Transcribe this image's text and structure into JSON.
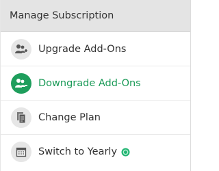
{
  "header": {
    "title": "Manage Subscription"
  },
  "menu": {
    "items": [
      {
        "label": "Upgrade Add-Ons",
        "icon": "upgrade-addons-icon",
        "active": false
      },
      {
        "label": "Downgrade Add-Ons",
        "icon": "downgrade-addons-icon",
        "active": true
      },
      {
        "label": "Change Plan",
        "icon": "change-plan-icon",
        "active": false
      },
      {
        "label": "Switch to Yearly",
        "icon": "calendar-icon",
        "active": false,
        "badge": "savings-badge-icon"
      }
    ]
  },
  "colors": {
    "header_bg": "#e4e4e4",
    "active_green": "#1a9a57",
    "icon_circle": "#e6e6e6",
    "badge_green": "#22b573"
  }
}
